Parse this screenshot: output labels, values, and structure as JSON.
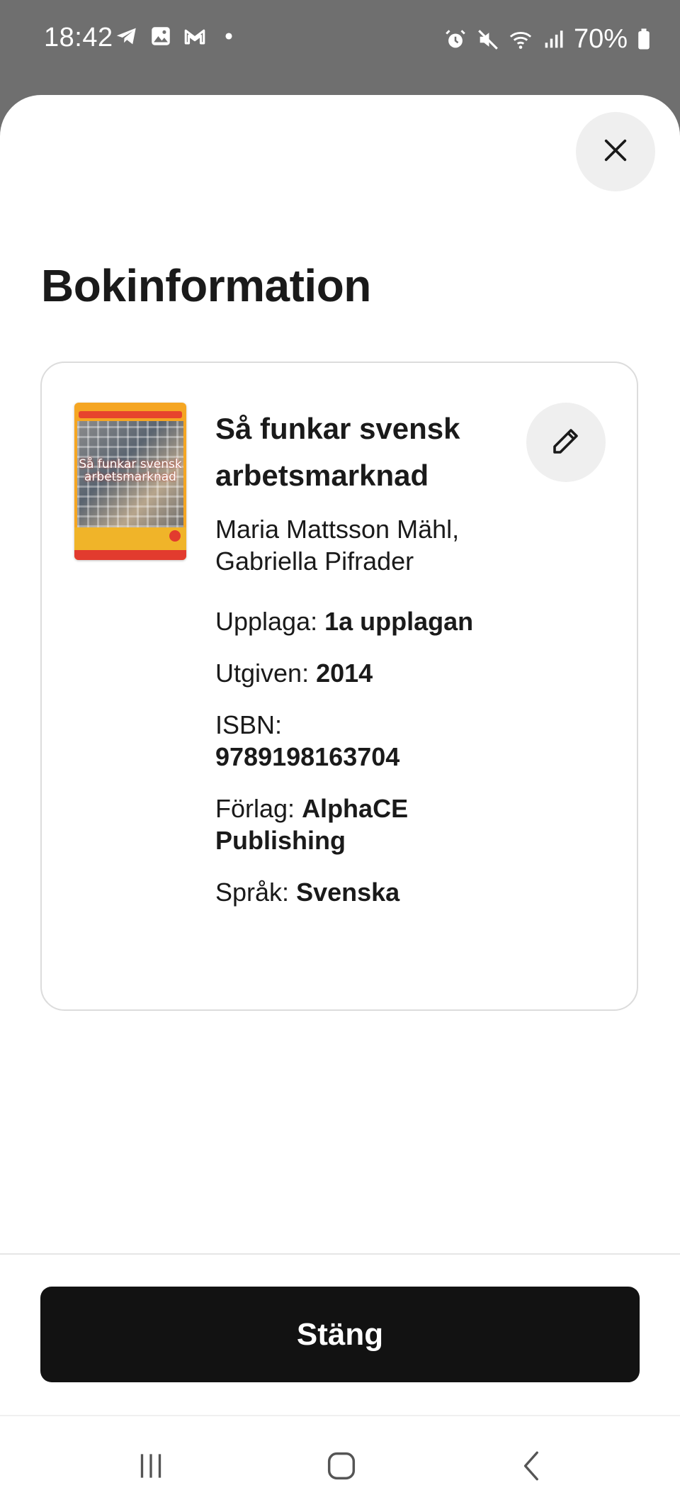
{
  "status_bar": {
    "time": "18:42",
    "battery": "70%",
    "left_icons": [
      "telegram-icon",
      "gallery-icon",
      "gmail-icon",
      "dot-icon"
    ],
    "right_icons": [
      "alarm-icon",
      "mute-icon",
      "wifi-icon",
      "signal-icon",
      "battery-icon"
    ]
  },
  "sheet": {
    "title": "Bokinformation",
    "close_icon": "close-icon"
  },
  "book": {
    "title": "Så funkar svensk arbetsmarknad",
    "authors": "Maria Mattsson Mähl, Gabriella Pifrader",
    "cover_title": "Så funkar svensk arbetsmarknad",
    "edit_icon": "pencil-icon",
    "details": {
      "edition_label": "Upplaga:",
      "edition_value": "1a upplagan",
      "published_label": "Utgiven:",
      "published_value": "2014",
      "isbn_label": "ISBN:",
      "isbn_value": "9789198163704",
      "publisher_label": "Förlag:",
      "publisher_value": "AlphaCE Publishing",
      "language_label": "Språk:",
      "language_value": "Svenska"
    }
  },
  "footer": {
    "close_button_label": "Stäng"
  },
  "navbar": {
    "items": [
      "recent-apps-icon",
      "home-icon",
      "back-icon"
    ]
  },
  "colors": {
    "status_bar_bg": "#6f6f6f",
    "button_dark": "#121212",
    "icon_button_bg": "#efefef",
    "card_border": "#dcdcdc",
    "cover_orange": "#f5a623",
    "cover_red": "#e23b2e"
  }
}
